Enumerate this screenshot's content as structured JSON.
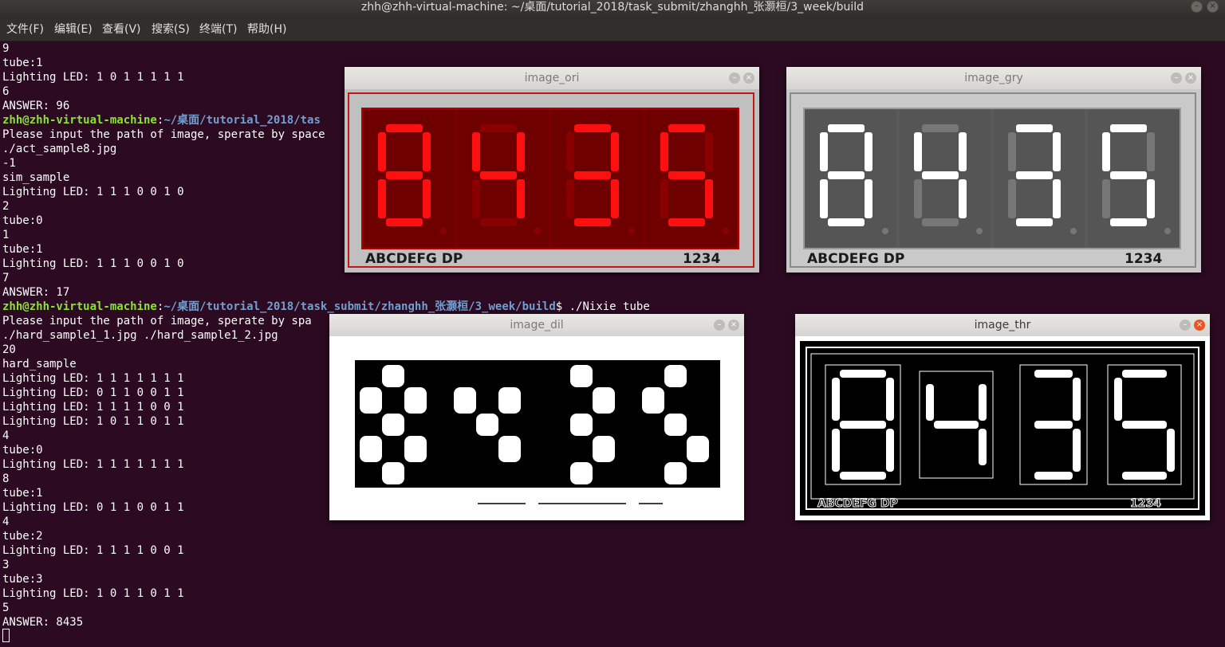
{
  "window_title": "zhh@zhh-virtual-machine: ~/桌面/tutorial_2018/task_submit/zhanghh_张灏桓/3_week/build",
  "menu": [
    "文件(F)",
    "编辑(E)",
    "查看(V)",
    "搜索(S)",
    "终端(T)",
    "帮助(H)"
  ],
  "prompt": {
    "user": "zhh@zhh-virtual-machine",
    "path_short": "~/桌面/tutorial_2018/tas",
    "path_full": "~/桌面/tutorial_2018/task_submit/zhanghh_张灏桓/3_week/build",
    "command": "$ ./Nixie tube"
  },
  "lines": {
    "l1": "9",
    "l2": "tube:1",
    "l3": "Lighting LED: 1 0 1 1 1 1 1",
    "l4": "6",
    "l5": "ANSWER: 96",
    "l7": "Please input the path of image, sperate by space",
    "l8": "./act_sample8.jpg",
    "l9": "-1",
    "l10": "sim_sample",
    "l11": "Lighting LED: 1 1 1 0 0 1 0",
    "l12": "2",
    "l13": "tube:0",
    "l14": "1",
    "l15": "tube:1",
    "l16": "Lighting LED: 1 1 1 0 0 1 0",
    "l17": "7",
    "l18": "ANSWER: 17",
    "l20": "Please input the path of image, sperate by spa",
    "l21": "./hard_sample1_1.jpg ./hard_sample1_2.jpg",
    "l22": "20",
    "l23": "hard_sample",
    "l24": "Lighting LED: 1 1 1 1 1 1 1",
    "l25": "Lighting LED: 0 1 1 0 0 1 1",
    "l26": "Lighting LED: 1 1 1 1 0 0 1",
    "l27": "Lighting LED: 1 0 1 1 0 1 1",
    "l28": "4",
    "l29": "tube:0",
    "l30": "Lighting LED: 1 1 1 1 1 1 1",
    "l31": "8",
    "l32": "tube:1",
    "l33": "Lighting LED: 0 1 1 0 0 1 1",
    "l34": "4",
    "l35": "tube:2",
    "l36": "Lighting LED: 1 1 1 1 0 0 1",
    "l37": "3",
    "l38": "tube:3",
    "l39": "Lighting LED: 1 0 1 1 0 1 1",
    "l40": "5",
    "l41": "ANSWER: 8435"
  },
  "windows": {
    "ori": {
      "title": "image_ori"
    },
    "gry": {
      "title": "image_gry"
    },
    "dil": {
      "title": "image_dil"
    },
    "thr": {
      "title": "image_thr"
    }
  },
  "display": {
    "digits": [
      8,
      4,
      3,
      5
    ],
    "label_left": "ABCDEFG  DP",
    "label_right": "1234"
  },
  "colors": {
    "terminal_bg": "#2c0a22",
    "prompt_user": "#8ae234",
    "prompt_path": "#729fcf",
    "led_on": "#ff1010",
    "led_off": "#8a0000",
    "led_bg": "#7a0000",
    "close_button": "#e95420"
  },
  "icons": {
    "minimize": "minimize-icon",
    "close": "close-icon"
  }
}
